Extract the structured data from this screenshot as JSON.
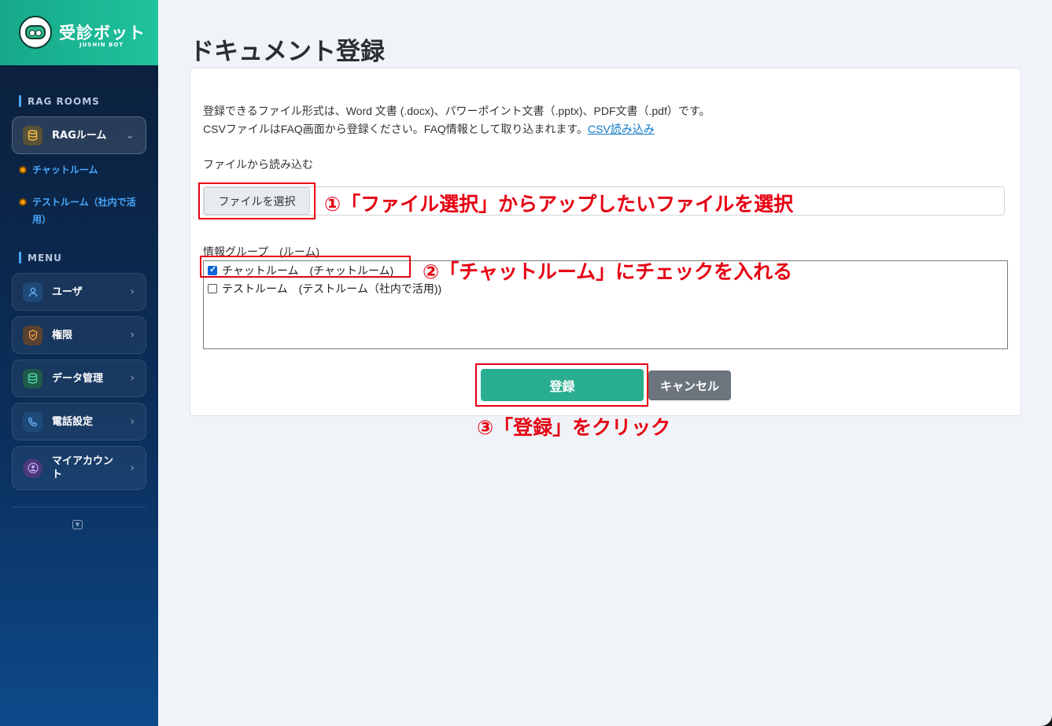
{
  "brand": {
    "title": "受診ボット",
    "subtitle": "JUSHIN BOT"
  },
  "sidebar": {
    "rag_section": "RAG ROOMS",
    "rag_item": "RAGルーム",
    "rooms": [
      "チャットルーム",
      "テストルーム（社内で活用）"
    ],
    "menu_section": "MENU",
    "menu": [
      {
        "label": "ユーザ",
        "icon": "user-icon"
      },
      {
        "label": "権限",
        "icon": "shield-icon"
      },
      {
        "label": "データ管理",
        "icon": "database-icon"
      },
      {
        "label": "電話設定",
        "icon": "phone-icon"
      },
      {
        "label": "マイアカウント",
        "icon": "account-icon"
      }
    ]
  },
  "main": {
    "title": "ドキュメント登録",
    "desc_line1": "登録できるファイル形式は、Word 文書 (.docx)、パワーポイント文書（.pptx)、PDF文書（.pdf）です。",
    "desc_line2": "CSVファイルはFAQ画面から登録ください。FAQ情報として取り込まれます。",
    "csv_link": "CSV読み込み",
    "file_label": "ファイルから読み込む",
    "file_button": "ファイルを選択",
    "group_label": "情報グループ　(ルーム)",
    "options": [
      {
        "label": "チャットルーム　(チャットルーム)",
        "checked": true
      },
      {
        "label": "テストルーム　(テストルーム（社内で活用))",
        "checked": false
      }
    ],
    "submit": "登録",
    "cancel": "キャンセル"
  },
  "annotations": {
    "step1": "①「ファイル選択」からアップしたいファイルを選択",
    "step2": "②「チャットルーム」にチェックを入れる",
    "step3": "③「登録」をクリック",
    "color": "#e60012"
  },
  "colors": {
    "accent": "#2aae92",
    "sidebar": "#0b2f5c",
    "link": "#0d79c4"
  }
}
